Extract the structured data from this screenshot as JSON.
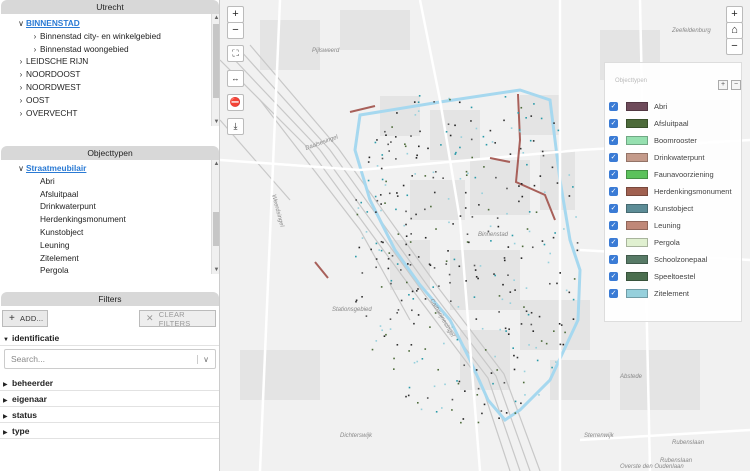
{
  "area_panel": {
    "title": "Utrecht",
    "items": [
      {
        "label": "BINNENSTAD",
        "arrow": "∨",
        "indent": 16,
        "selected": true
      },
      {
        "label": "Binnenstad city- en winkelgebied",
        "arrow": "›",
        "indent": 30,
        "selected": false
      },
      {
        "label": "Binnenstad woongebied",
        "arrow": "›",
        "indent": 30,
        "selected": false
      },
      {
        "label": "LEIDSCHE RIJN",
        "arrow": "›",
        "indent": 16,
        "selected": false
      },
      {
        "label": "NOORDOOST",
        "arrow": "›",
        "indent": 16,
        "selected": false
      },
      {
        "label": "NOORDWEST",
        "arrow": "›",
        "indent": 16,
        "selected": false
      },
      {
        "label": "OOST",
        "arrow": "›",
        "indent": 16,
        "selected": false
      },
      {
        "label": "OVERVECHT",
        "arrow": "›",
        "indent": 16,
        "selected": false
      }
    ]
  },
  "type_panel": {
    "title": "Objecttypen",
    "items": [
      {
        "label": "Straatmeubilair",
        "arrow": "∨",
        "indent": 16,
        "selected": true
      },
      {
        "label": "Abri",
        "arrow": "",
        "indent": 30,
        "selected": false
      },
      {
        "label": "Afsluitpaal",
        "arrow": "",
        "indent": 30,
        "selected": false
      },
      {
        "label": "Drinkwaterpunt",
        "arrow": "",
        "indent": 30,
        "selected": false
      },
      {
        "label": "Herdenkingsmonument",
        "arrow": "",
        "indent": 30,
        "selected": false
      },
      {
        "label": "Kunstobject",
        "arrow": "",
        "indent": 30,
        "selected": false
      },
      {
        "label": "Leuning",
        "arrow": "",
        "indent": 30,
        "selected": false
      },
      {
        "label": "Zitelement",
        "arrow": "",
        "indent": 30,
        "selected": false
      },
      {
        "label": "Pergola",
        "arrow": "",
        "indent": 30,
        "selected": false
      }
    ]
  },
  "filters": {
    "title": "Filters",
    "add_label": "ADD...",
    "clear_label": "CLEAR FILTERS",
    "sections": {
      "identificatie": "identificatie",
      "beheerder": "beheerder",
      "eigenaar": "eigenaar",
      "status": "status",
      "type": "type"
    },
    "search_placeholder": "Search..."
  },
  "map": {
    "controls": {
      "zoom_in": "+",
      "zoom_out": "−",
      "home": "⌂"
    },
    "labels": [
      {
        "text": "Pijlsweerd"
      },
      {
        "text": "Zeefeldenburg"
      },
      {
        "text": "Binnenstad"
      },
      {
        "text": "Stationsgebied"
      },
      {
        "text": "Catharijnesingel"
      },
      {
        "text": "Dichterswijk"
      },
      {
        "text": "Abstede"
      },
      {
        "text": "Sterrenwijk"
      },
      {
        "text": "Rubenslaan"
      },
      {
        "text": "Rubenslaan"
      },
      {
        "text": "Overste den Oudenlaan"
      },
      {
        "text": "Daalsesingel"
      },
      {
        "text": "Weerdsingel"
      }
    ]
  },
  "legend": {
    "title": "Objecttypen",
    "plus": "+",
    "minus": "−",
    "items": [
      {
        "label": "Abri",
        "color": "#6e4a5a"
      },
      {
        "label": "Afsluitpaal",
        "color": "#4d6b3a"
      },
      {
        "label": "Boomrooster",
        "color": "#96e0b0"
      },
      {
        "label": "Drinkwaterpunt",
        "color": "#c49a8a"
      },
      {
        "label": "Faunavoorziening",
        "color": "#5cc25c"
      },
      {
        "label": "Herdenkingsmonument",
        "color": "#a06050"
      },
      {
        "label": "Kunstobject",
        "color": "#5c8c96"
      },
      {
        "label": "Leuning",
        "color": "#c08878"
      },
      {
        "label": "Pergola",
        "color": "#e0f0d0"
      },
      {
        "label": "Schoolzonepaal",
        "color": "#577a66"
      },
      {
        "label": "Speeltoestel",
        "color": "#4a6e4e"
      },
      {
        "label": "Zitelement",
        "color": "#96d0dc"
      }
    ]
  }
}
